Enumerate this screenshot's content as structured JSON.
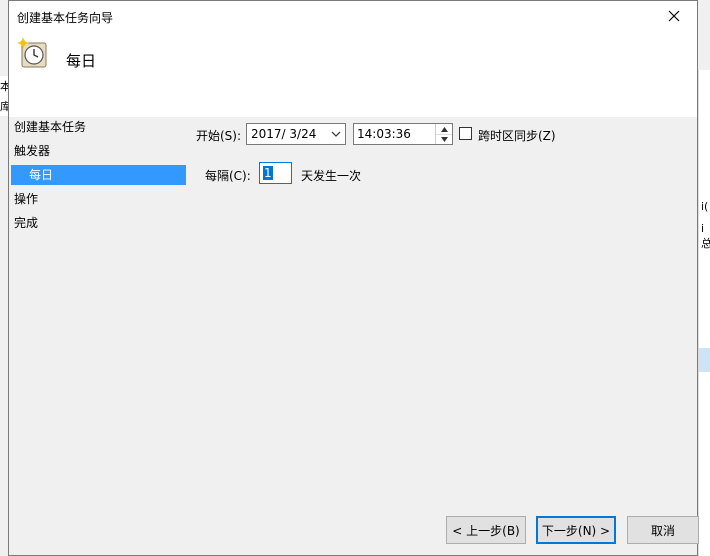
{
  "dialog": {
    "title": "创建基本任务向导",
    "header_title": "每日"
  },
  "nav": {
    "items": [
      "创建基本任务",
      "触发器",
      "每日",
      "操作",
      "完成"
    ],
    "selected": "每日"
  },
  "form": {
    "start_label": "开始(S):",
    "start_date": "2017/  3/24",
    "start_time": "14:03:36",
    "sync_timezone_label": "跨时区同步(Z)",
    "sync_timezone_checked": false,
    "interval_label": "每隔(C):",
    "interval_value": "1",
    "interval_suffix": "天发生一次"
  },
  "buttons": {
    "back": "< 上一步(B)",
    "next": "下一步(N) >",
    "cancel": "取消"
  },
  "background": {
    "left_frag_1": "本",
    "left_frag_2": "库",
    "right_frag_1": "i(",
    "right_frag_2": "i总"
  },
  "colors": {
    "selection": "#3399ff",
    "accent": "#0078d7"
  }
}
